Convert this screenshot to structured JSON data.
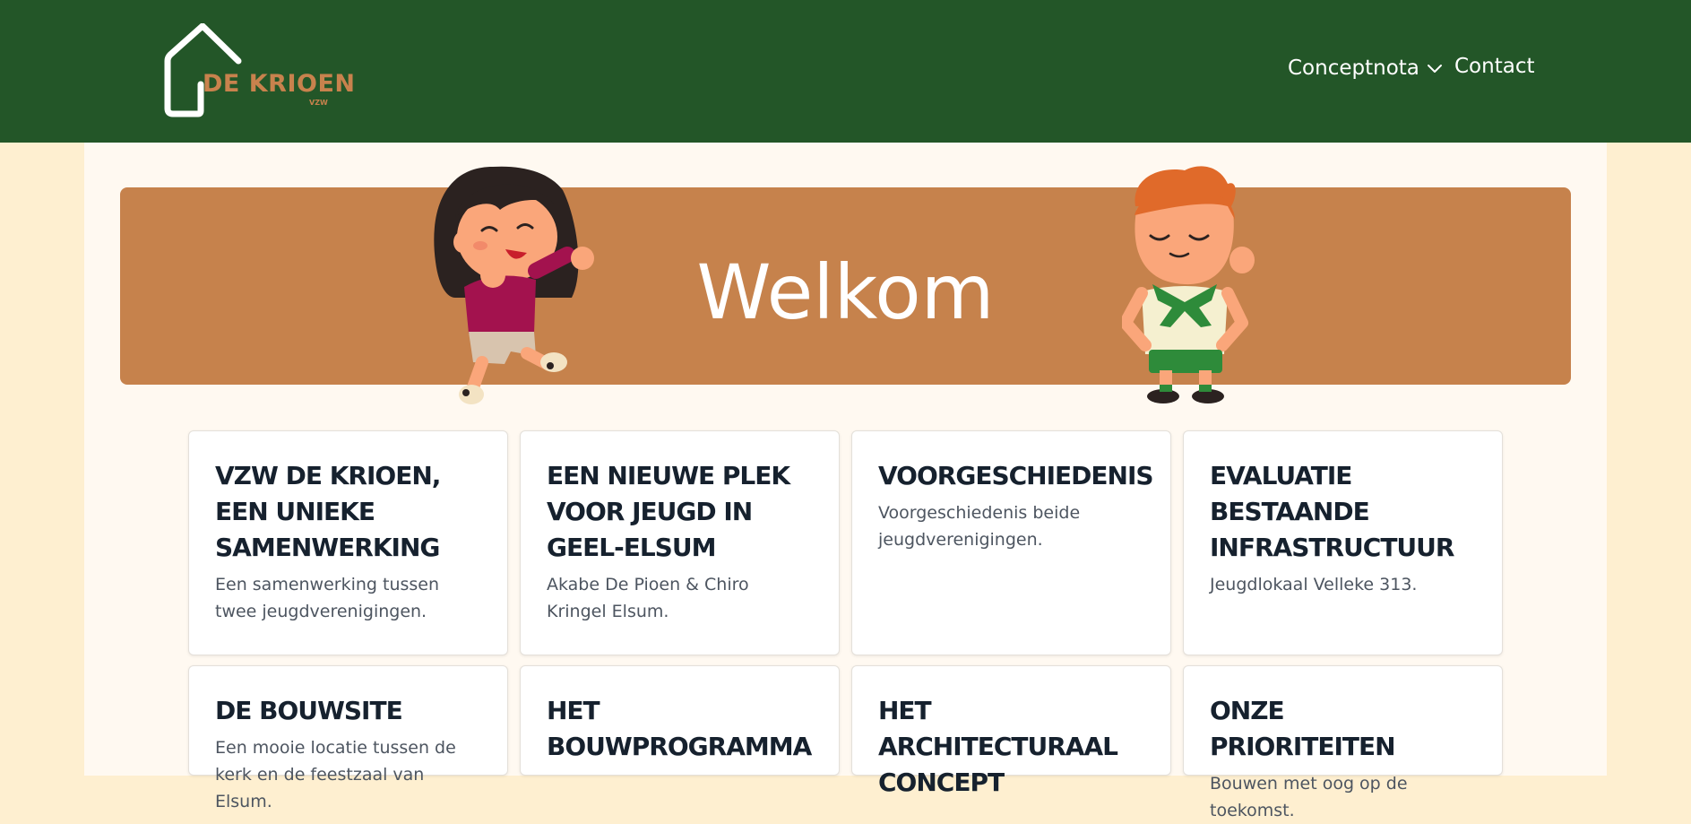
{
  "header": {
    "logo_text": "DE KRIOEN",
    "logo_subtext": "VZW",
    "nav": {
      "conceptnota": "Conceptnota",
      "contact": "Contact"
    }
  },
  "hero": {
    "title": "Welkom"
  },
  "cards": [
    {
      "title": "VZW DE KRIOEN, EEN UNIEKE SAMENWERKING",
      "desc": "Een samenwerking tussen twee jeugdverenigingen."
    },
    {
      "title": "EEN NIEUWE PLEK VOOR JEUGD IN GEEL-ELSUM",
      "desc": "Akabe De Pioen & Chiro Kringel Elsum."
    },
    {
      "title": "VOORGESCHIEDENIS",
      "desc": "Voorgeschiedenis beide jeugdverenigingen."
    },
    {
      "title": "EVALUATIE BESTAANDE INFRASTRUCTUUR",
      "desc": "Jeugdlokaal Velleke 313."
    },
    {
      "title": "DE BOUWSITE",
      "desc": "Een mooie locatie tussen de kerk en de feestzaal van Elsum."
    },
    {
      "title": "HET BOUWPROGRAMMA",
      "desc": ""
    },
    {
      "title": "HET ARCHITECTURAAL CONCEPT",
      "desc": ""
    },
    {
      "title": "ONZE PRIORITEITEN",
      "desc": "Bouwen met oog op de toekomst."
    }
  ],
  "colors": {
    "header_green": "#235628",
    "accent_brown": "#C6824C",
    "page_bg": "#FEEFD0",
    "content_bg": "#FFF9F1"
  },
  "icons": [
    "house-logo-icon",
    "chevron-down-icon",
    "girl-character-illustration",
    "boy-scout-illustration"
  ]
}
